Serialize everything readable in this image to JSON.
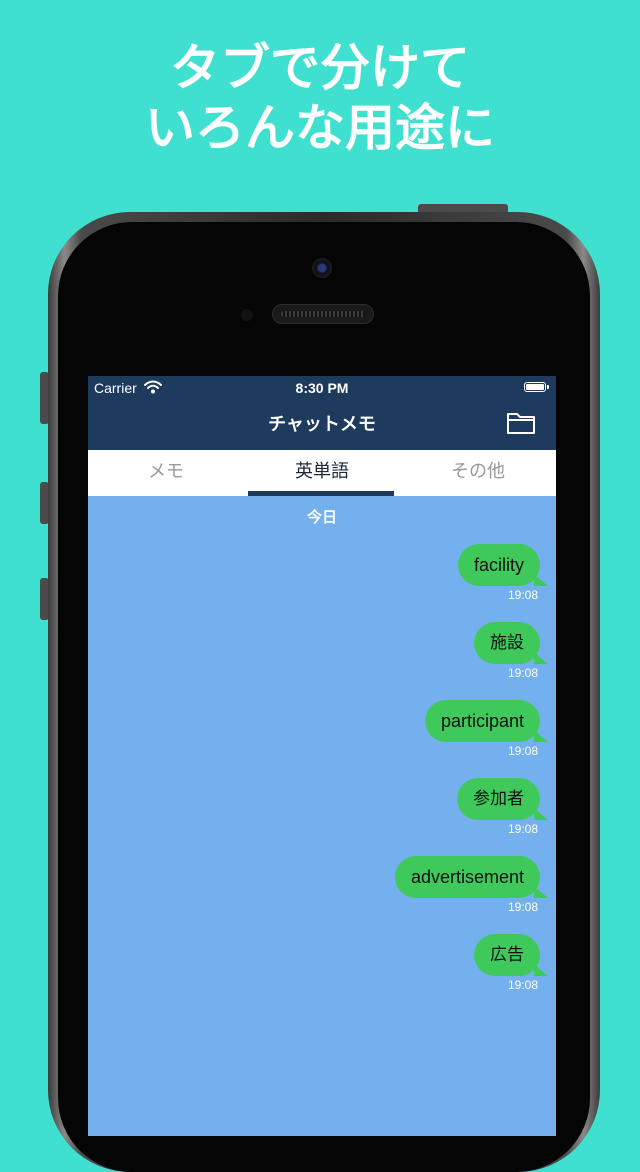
{
  "headline": {
    "line1": "タブで分けて",
    "line2": "いろんな用途に"
  },
  "status_bar": {
    "carrier": "Carrier",
    "time": "8:30 PM",
    "battery_level": 1.0
  },
  "nav": {
    "title": "チャットメモ",
    "folder_icon": "folder-icon"
  },
  "tabs": [
    {
      "label": "メモ",
      "active": false
    },
    {
      "label": "英単語",
      "active": true
    },
    {
      "label": "その他",
      "active": false
    }
  ],
  "day_label": "今日",
  "messages": [
    {
      "text": "facility",
      "time": "19:08"
    },
    {
      "text": "施設",
      "time": "19:08"
    },
    {
      "text": "participant",
      "time": "19:08"
    },
    {
      "text": "参加者",
      "time": "19:08"
    },
    {
      "text": "advertisement",
      "time": "19:08"
    },
    {
      "text": "広告",
      "time": "19:08"
    }
  ],
  "colors": {
    "page_background": "#40E0D0",
    "navbar": "#1E3A5C",
    "chat_background": "#74B0EE",
    "bubble": "#3EC95A"
  }
}
